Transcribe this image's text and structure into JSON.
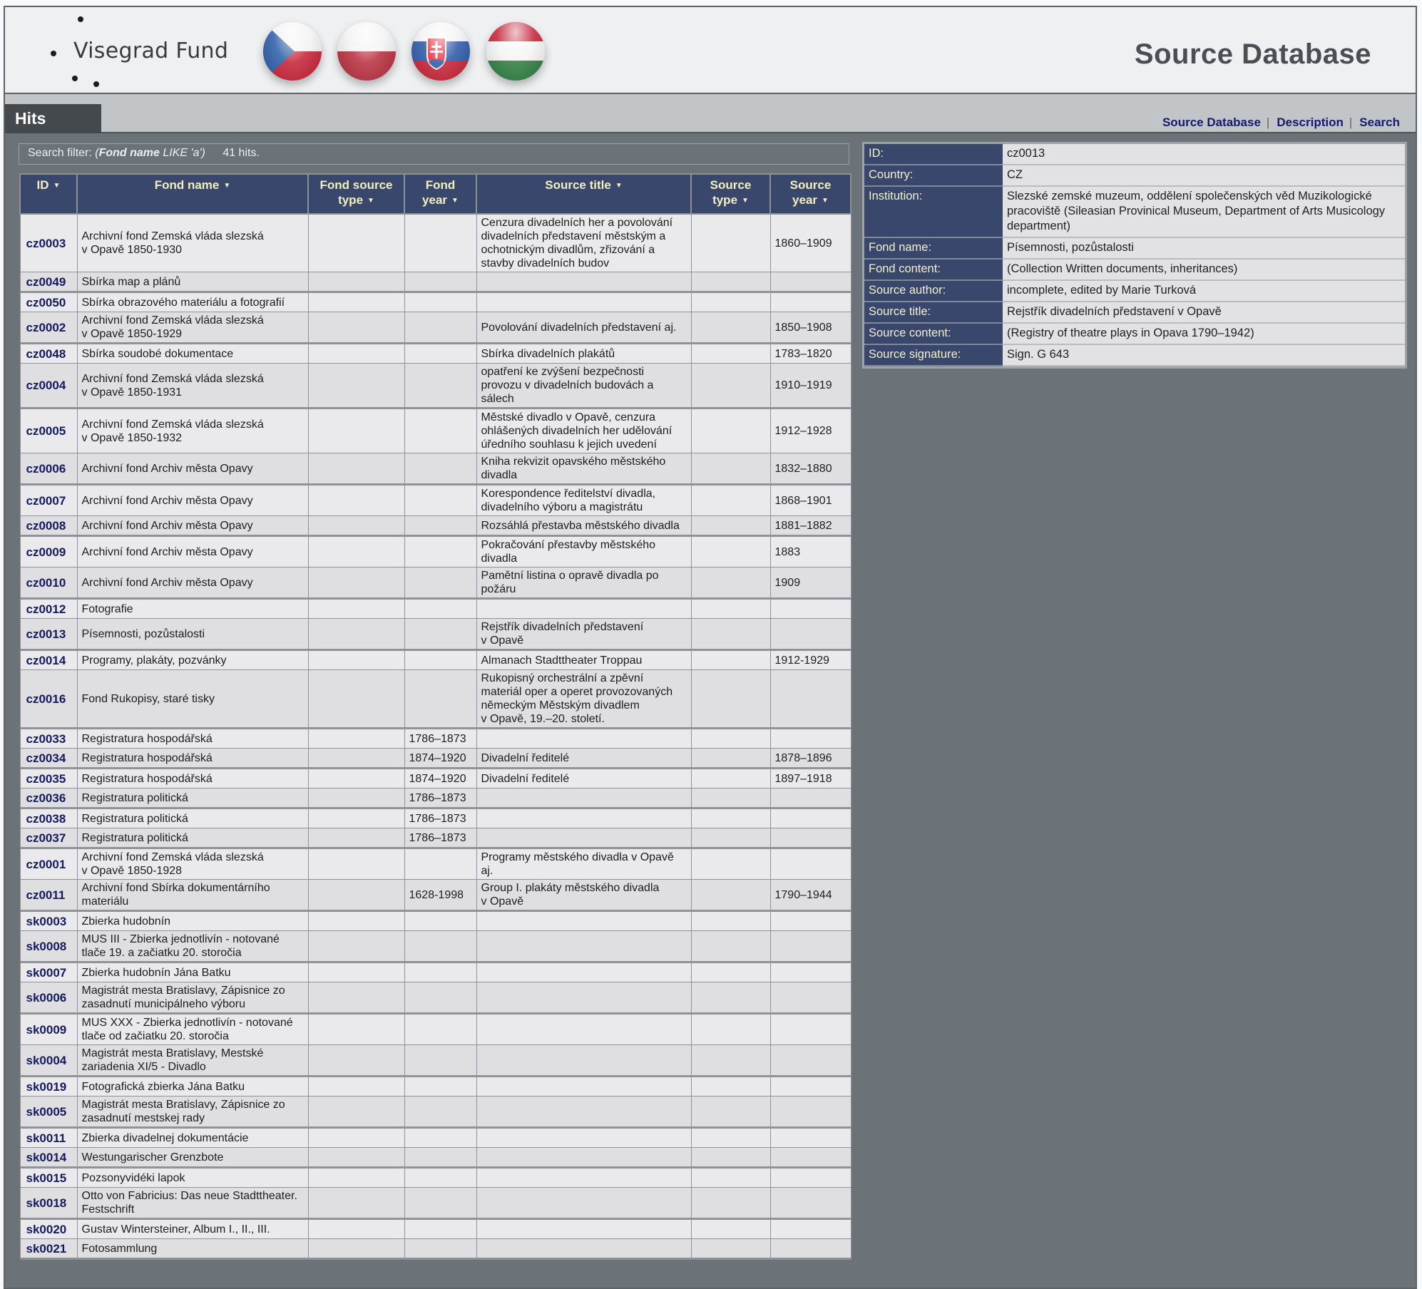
{
  "header": {
    "logo_text": "Visegrad Fund",
    "app_title": "Source Database",
    "flags": [
      {
        "country": "Czech Republic",
        "icon": "czech-flag-icon"
      },
      {
        "country": "Poland",
        "icon": "poland-flag-icon"
      },
      {
        "country": "Slovakia",
        "icon": "slovakia-flag-icon"
      },
      {
        "country": "Hungary",
        "icon": "hungary-flag-icon"
      }
    ]
  },
  "nav": {
    "active_tab": "Hits",
    "links": [
      "Source Database",
      "Description",
      "Search"
    ],
    "separator": "|"
  },
  "filter": {
    "prefix": "Search filter:",
    "open_paren": "(",
    "field": "Fond name",
    "operator": " LIKE 'a')",
    "count_text": "41 hits."
  },
  "table": {
    "sort_icon": "▼",
    "columns": [
      {
        "line1": "ID",
        "line2": ""
      },
      {
        "line1": "Fond name",
        "line2": ""
      },
      {
        "line1": "Fond source",
        "line2": "type"
      },
      {
        "line1": "Fond",
        "line2": "year"
      },
      {
        "line1": "Source title",
        "line2": ""
      },
      {
        "line1": "Source",
        "line2": "type"
      },
      {
        "line1": "Source",
        "line2": "year"
      }
    ],
    "rows": [
      {
        "id": "cz0003",
        "fond_name": "Archivní fond Zemská vláda slezská\nv Opavě 1850-1930",
        "fond_source_type": "",
        "fond_year": "",
        "source_title": "Cenzura divadelních her a povolování divadelních představení městským a ochotnickým divadlům, zřizování a stavby divadelních budov",
        "source_type": "",
        "source_year": "1860–1909"
      },
      {
        "id": "cz0049",
        "fond_name": "Sbírka map a plánů",
        "fond_source_type": "",
        "fond_year": "",
        "source_title": "",
        "source_type": "",
        "source_year": ""
      },
      {
        "id": "cz0050",
        "fond_name": "Sbírka obrazového materiálu a fotografií",
        "fond_source_type": "",
        "fond_year": "",
        "source_title": "",
        "source_type": "",
        "source_year": ""
      },
      {
        "id": "cz0002",
        "fond_name": "Archivní fond Zemská vláda slezská\nv Opavě 1850-1929",
        "fond_source_type": "",
        "fond_year": "",
        "source_title": "Povolování divadelních představení aj.",
        "source_type": "",
        "source_year": "1850–1908"
      },
      {
        "id": "cz0048",
        "fond_name": "Sbírka soudobé dokumentace",
        "fond_source_type": "",
        "fond_year": "",
        "source_title": "Sbírka divadelních plakátů",
        "source_type": "",
        "source_year": "1783–1820"
      },
      {
        "id": "cz0004",
        "fond_name": "Archivní fond Zemská vláda slezská\nv Opavě 1850-1931",
        "fond_source_type": "",
        "fond_year": "",
        "source_title": "opatření ke zvýšení bezpečnosti provozu v divadelních budovách a sálech",
        "source_type": "",
        "source_year": "1910–1919"
      },
      {
        "id": "cz0005",
        "fond_name": "Archivní fond Zemská vláda slezská\nv Opavě 1850-1932",
        "fond_source_type": "",
        "fond_year": "",
        "source_title": "Městské divadlo v Opavě, cenzura ohlášených divadelních her udělování úředního souhlasu k jejich uvedení",
        "source_type": "",
        "source_year": "1912–1928"
      },
      {
        "id": "cz0006",
        "fond_name": "Archivní fond Archiv města Opavy",
        "fond_source_type": "",
        "fond_year": "",
        "source_title": "Kniha rekvizit opavského městského divadla",
        "source_type": "",
        "source_year": "1832–1880"
      },
      {
        "id": "cz0007",
        "fond_name": "Archivní fond Archiv města Opavy",
        "fond_source_type": "",
        "fond_year": "",
        "source_title": "Korespondence ředitelství divadla, divadelního výboru a magistrátu",
        "source_type": "",
        "source_year": "1868–1901"
      },
      {
        "id": "cz0008",
        "fond_name": "Archivní fond Archiv města Opavy",
        "fond_source_type": "",
        "fond_year": "",
        "source_title": "Rozsáhlá přestavba městského divadla",
        "source_type": "",
        "source_year": "1881–1882"
      },
      {
        "id": "cz0009",
        "fond_name": "Archivní fond Archiv města Opavy",
        "fond_source_type": "",
        "fond_year": "",
        "source_title": "Pokračování přestavby městského divadla",
        "source_type": "",
        "source_year": "1883"
      },
      {
        "id": "cz0010",
        "fond_name": "Archivní fond Archiv města Opavy",
        "fond_source_type": "",
        "fond_year": "",
        "source_title": "Pamětní listina o opravě divadla po požáru",
        "source_type": "",
        "source_year": "1909"
      },
      {
        "id": "cz0012",
        "fond_name": "Fotografie",
        "fond_source_type": "",
        "fond_year": "",
        "source_title": "",
        "source_type": "",
        "source_year": ""
      },
      {
        "id": "cz0013",
        "fond_name": "Písemnosti, pozůstalosti",
        "fond_source_type": "",
        "fond_year": "",
        "source_title": "Rejstřík divadelních představení\nv Opavě",
        "source_type": "",
        "source_year": ""
      },
      {
        "id": "cz0014",
        "fond_name": "Programy, plakáty, pozvánky",
        "fond_source_type": "",
        "fond_year": "",
        "source_title": "Almanach Stadttheater Troppau",
        "source_type": "",
        "source_year": "1912-1929"
      },
      {
        "id": "cz0016",
        "fond_name": "Fond Rukopisy, staré tisky",
        "fond_source_type": "",
        "fond_year": "",
        "source_title": "Rukopisný orchestrální a zpěvní materiál oper a operet provozovaných německým Městským divadlem\nv Opavě, 19.–20. století.",
        "source_type": "",
        "source_year": ""
      },
      {
        "id": "cz0033",
        "fond_name": "Registratura hospodářská",
        "fond_source_type": "",
        "fond_year": "1786–1873",
        "source_title": "",
        "source_type": "",
        "source_year": ""
      },
      {
        "id": "cz0034",
        "fond_name": "Registratura hospodářská",
        "fond_source_type": "",
        "fond_year": "1874–1920",
        "source_title": "Divadelní ředitelé",
        "source_type": "",
        "source_year": "1878–1896"
      },
      {
        "id": "cz0035",
        "fond_name": "Registratura hospodářská",
        "fond_source_type": "",
        "fond_year": "1874–1920",
        "source_title": "Divadelní ředitelé",
        "source_type": "",
        "source_year": "1897–1918"
      },
      {
        "id": "cz0036",
        "fond_name": "Registratura politická",
        "fond_source_type": "",
        "fond_year": "1786–1873",
        "source_title": "",
        "source_type": "",
        "source_year": ""
      },
      {
        "id": "cz0038",
        "fond_name": "Registratura politická",
        "fond_source_type": "",
        "fond_year": "1786–1873",
        "source_title": "",
        "source_type": "",
        "source_year": ""
      },
      {
        "id": "cz0037",
        "fond_name": "Registratura politická",
        "fond_source_type": "",
        "fond_year": "1786–1873",
        "source_title": "",
        "source_type": "",
        "source_year": ""
      },
      {
        "id": "cz0001",
        "fond_name": "Archivní fond Zemská vláda slezská\nv Opavě 1850-1928",
        "fond_source_type": "",
        "fond_year": "",
        "source_title": "Programy městského divadla v Opavě aj.",
        "source_type": "",
        "source_year": ""
      },
      {
        "id": "cz0011",
        "fond_name": "Archivní fond Sbírka dokumentárního materiálu",
        "fond_source_type": "",
        "fond_year": "1628-1998",
        "source_title": "Group I. plakáty městského divadla\nv Opavě",
        "source_type": "",
        "source_year": "1790–1944"
      },
      {
        "id": "sk0003",
        "fond_name": "Zbierka hudobnín",
        "fond_source_type": "",
        "fond_year": "",
        "source_title": "",
        "source_type": "",
        "source_year": ""
      },
      {
        "id": "sk0008",
        "fond_name": "MUS III - Zbierka jednotlivín - notované tlače 19. a začiatku 20. storočia",
        "fond_source_type": "",
        "fond_year": "",
        "source_title": "",
        "source_type": "",
        "source_year": ""
      },
      {
        "id": "sk0007",
        "fond_name": "Zbierka hudobnín Jána Batku",
        "fond_source_type": "",
        "fond_year": "",
        "source_title": "",
        "source_type": "",
        "source_year": ""
      },
      {
        "id": "sk0006",
        "fond_name": "Magistrát mesta Bratislavy, Zápisnice zo zasadnutí municipálneho výboru",
        "fond_source_type": "",
        "fond_year": "",
        "source_title": "",
        "source_type": "",
        "source_year": ""
      },
      {
        "id": "sk0009",
        "fond_name": "MUS XXX - Zbierka jednotlivín - notované tlače od začiatku 20. storočia",
        "fond_source_type": "",
        "fond_year": "",
        "source_title": "",
        "source_type": "",
        "source_year": ""
      },
      {
        "id": "sk0004",
        "fond_name": "Magistrát mesta Bratislavy, Mestské zariadenia XI/5 - Divadlo",
        "fond_source_type": "",
        "fond_year": "",
        "source_title": "",
        "source_type": "",
        "source_year": ""
      },
      {
        "id": "sk0019",
        "fond_name": "Fotografická zbierka Jána Batku",
        "fond_source_type": "",
        "fond_year": "",
        "source_title": "",
        "source_type": "",
        "source_year": ""
      },
      {
        "id": "sk0005",
        "fond_name": "Magistrát mesta Bratislavy, Zápisnice zo zasadnutí mestskej rady",
        "fond_source_type": "",
        "fond_year": "",
        "source_title": "",
        "source_type": "",
        "source_year": ""
      },
      {
        "id": "sk0011",
        "fond_name": "Zbierka divadelnej dokumentácie",
        "fond_source_type": "",
        "fond_year": "",
        "source_title": "",
        "source_type": "",
        "source_year": ""
      },
      {
        "id": "sk0014",
        "fond_name": "Westungarischer Grenzbote",
        "fond_source_type": "",
        "fond_year": "",
        "source_title": "",
        "source_type": "",
        "source_year": ""
      },
      {
        "id": "sk0015",
        "fond_name": "Pozsonyvidéki lapok",
        "fond_source_type": "",
        "fond_year": "",
        "source_title": "",
        "source_type": "",
        "source_year": ""
      },
      {
        "id": "sk0018",
        "fond_name": "Otto von Fabricius: Das neue Stadttheater. Festschrift",
        "fond_source_type": "",
        "fond_year": "",
        "source_title": "",
        "source_type": "",
        "source_year": ""
      },
      {
        "id": "sk0020",
        "fond_name": "Gustav Wintersteiner, Album I., II., III.",
        "fond_source_type": "",
        "fond_year": "",
        "source_title": "",
        "source_type": "",
        "source_year": ""
      },
      {
        "id": "sk0021",
        "fond_name": "Fotosammlung",
        "fond_source_type": "",
        "fond_year": "",
        "source_title": "",
        "source_type": "",
        "source_year": ""
      }
    ]
  },
  "detail": {
    "fields": [
      {
        "label": "ID:",
        "value": "cz0013"
      },
      {
        "label": "Country:",
        "value": "CZ"
      },
      {
        "label": "Institution:",
        "value": "Slezské zemské muzeum, oddělení společenských věd Muzikologické pracoviště (Sileasian Provinical Museum, Department of Arts Musicology department)"
      },
      {
        "label": "Fond name:",
        "value": "Písemnosti, pozůstalosti"
      },
      {
        "label": "Fond content:",
        "value": "(Collection Written documents, inheritances)"
      },
      {
        "label": "Source author:",
        "value": "incomplete, edited by Marie Turková"
      },
      {
        "label": "Source title:",
        "value": "Rejstřík divadelních představení v Opavě"
      },
      {
        "label": "Source content:",
        "value": "(Registry of theatre plays in Opava 1790–1942)"
      },
      {
        "label": "Source signature:",
        "value": "Sign. G 643"
      }
    ]
  },
  "colors": {
    "header_bg": "#38476b",
    "header_text": "#f4efc0",
    "link": "#151a6e",
    "page_bg": "#6b7379",
    "row_odd": "#eaeaec",
    "row_even": "#dfdfe1"
  }
}
